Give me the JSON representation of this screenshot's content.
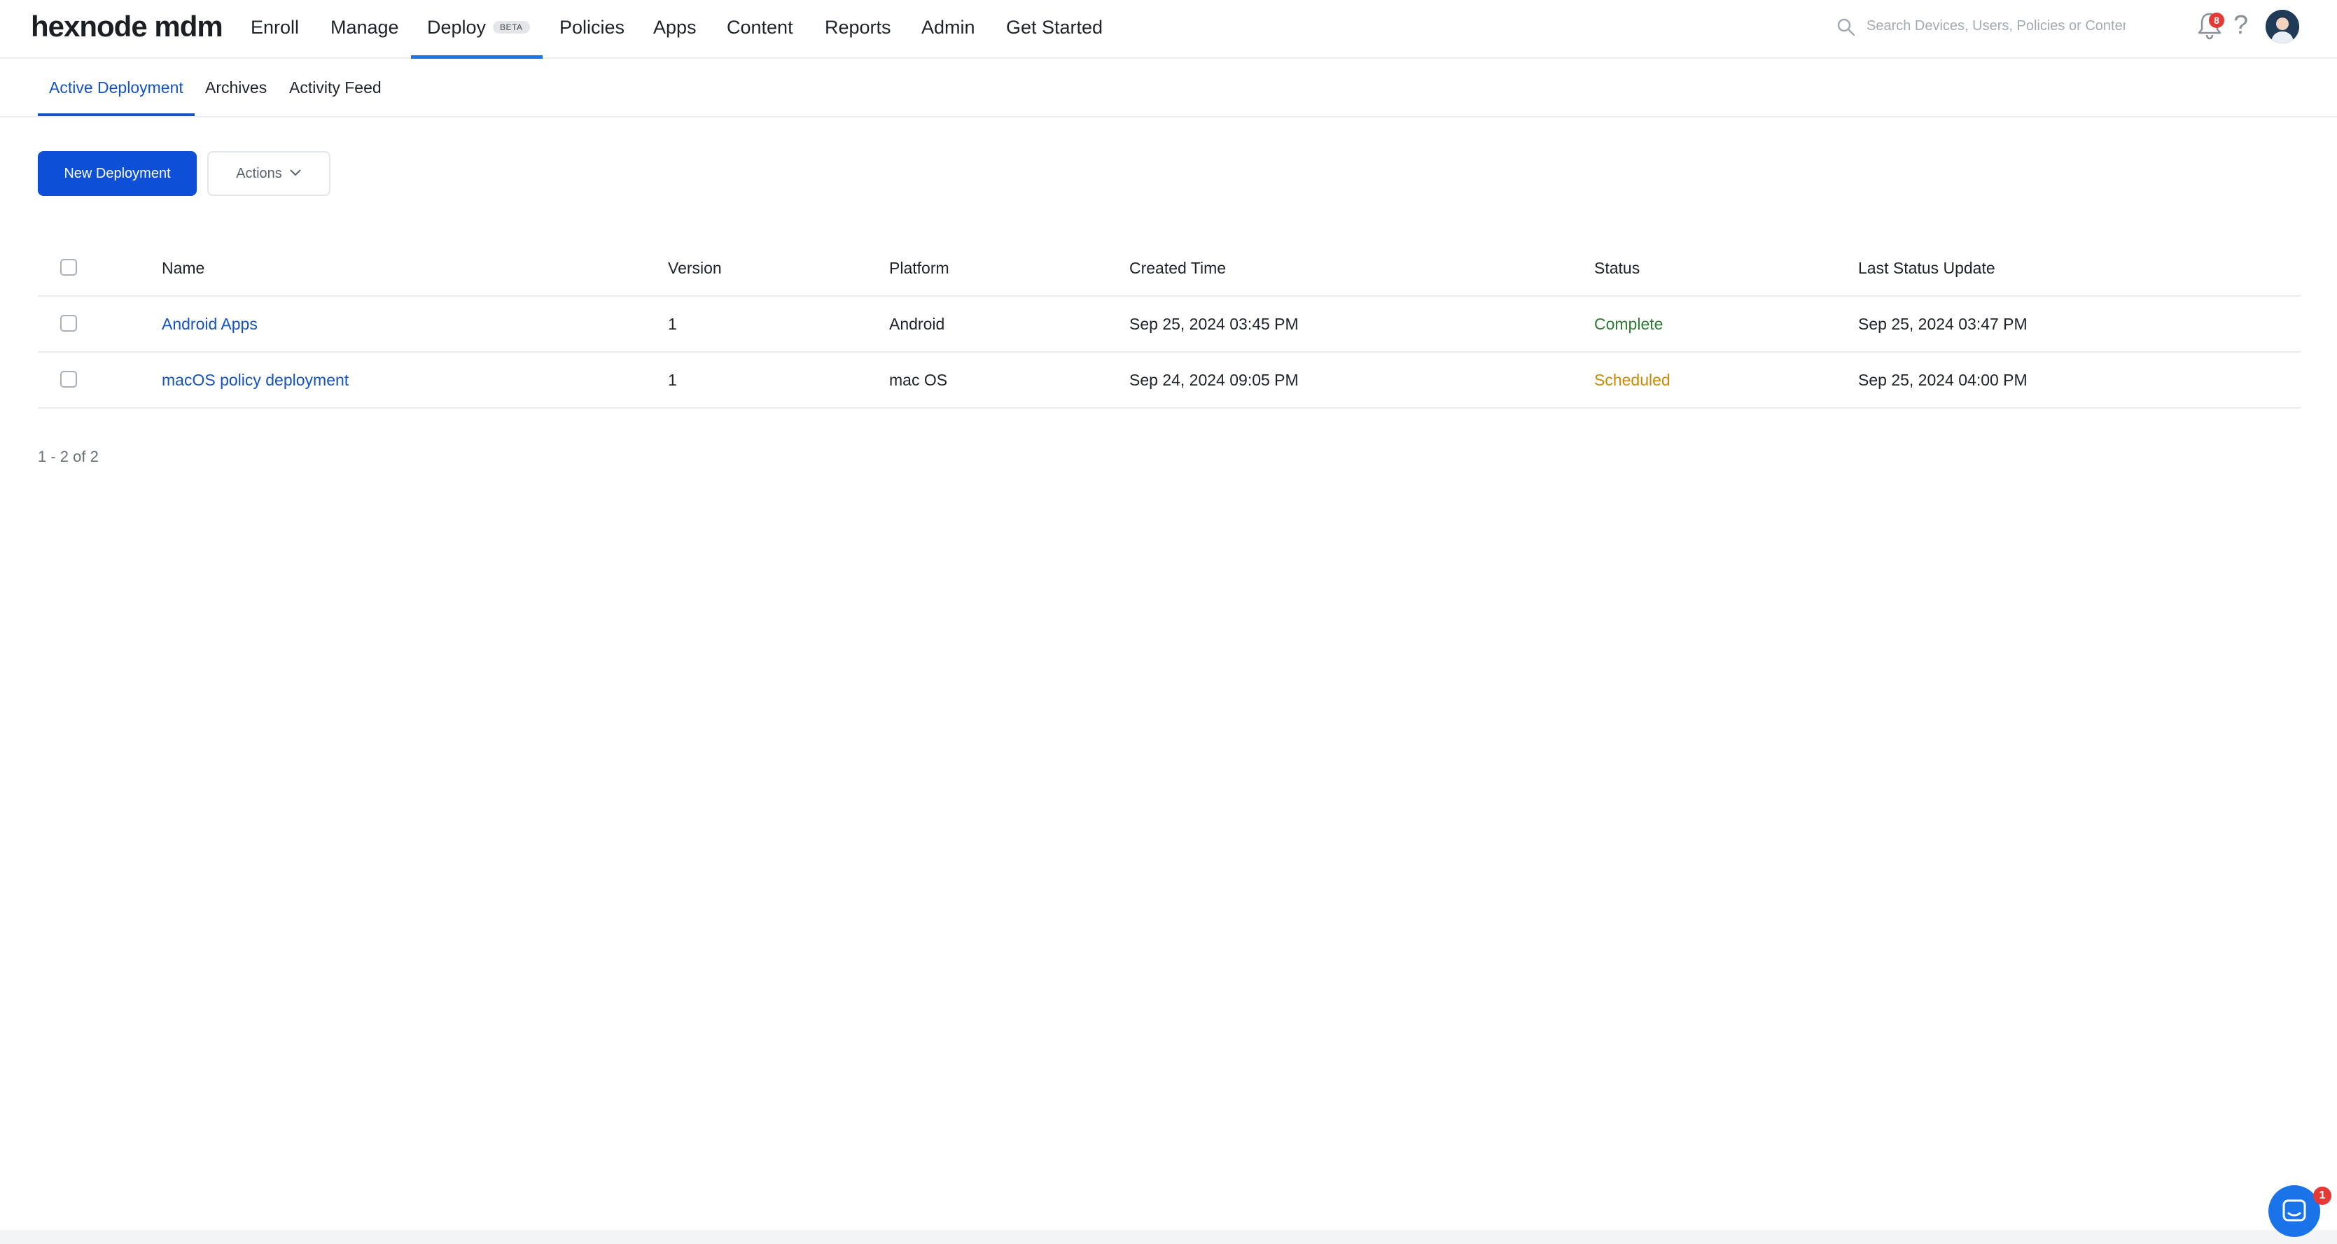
{
  "nav": {
    "logo": "hexnode mdm",
    "items": [
      {
        "label": "Enroll"
      },
      {
        "label": "Manage"
      },
      {
        "label": "Deploy",
        "badge": "BETA"
      },
      {
        "label": "Policies"
      },
      {
        "label": "Apps"
      },
      {
        "label": "Content"
      },
      {
        "label": "Reports"
      },
      {
        "label": "Admin"
      },
      {
        "label": "Get Started"
      }
    ],
    "search_placeholder": "Search Devices, Users, Policies or Content",
    "notification_count": "8",
    "help_label": "?",
    "accent_color": "#1a73e8"
  },
  "subtabs": [
    {
      "label": "Active Deployment"
    },
    {
      "label": "Archives"
    },
    {
      "label": "Activity Feed"
    }
  ],
  "toolbar": {
    "new_label": "New Deployment",
    "actions_label": "Actions"
  },
  "table": {
    "headers": {
      "name": "Name",
      "version": "Version",
      "platform": "Platform",
      "created": "Created Time",
      "status": "Status",
      "last_update": "Last Status Update"
    },
    "rows": [
      {
        "name": "Android Apps",
        "version": "1",
        "platform": "Android",
        "created": "Sep 25, 2024 03:45 PM",
        "status": "Complete",
        "last_update": "Sep 25, 2024 03:47 PM"
      },
      {
        "name": "macOS policy deployment",
        "version": "1",
        "platform": "mac OS",
        "created": "Sep 24, 2024 09:05 PM",
        "status": "Scheduled",
        "last_update": "Sep 25, 2024 04:00 PM"
      }
    ]
  },
  "pagination": {
    "text": "1 - 2 of 2"
  },
  "chat": {
    "badge": "1"
  },
  "colors": {
    "primary_button": "#0d4fd6",
    "link": "#1553c4",
    "status_complete": "#2e7d32",
    "status_scheduled": "#c98a00"
  }
}
